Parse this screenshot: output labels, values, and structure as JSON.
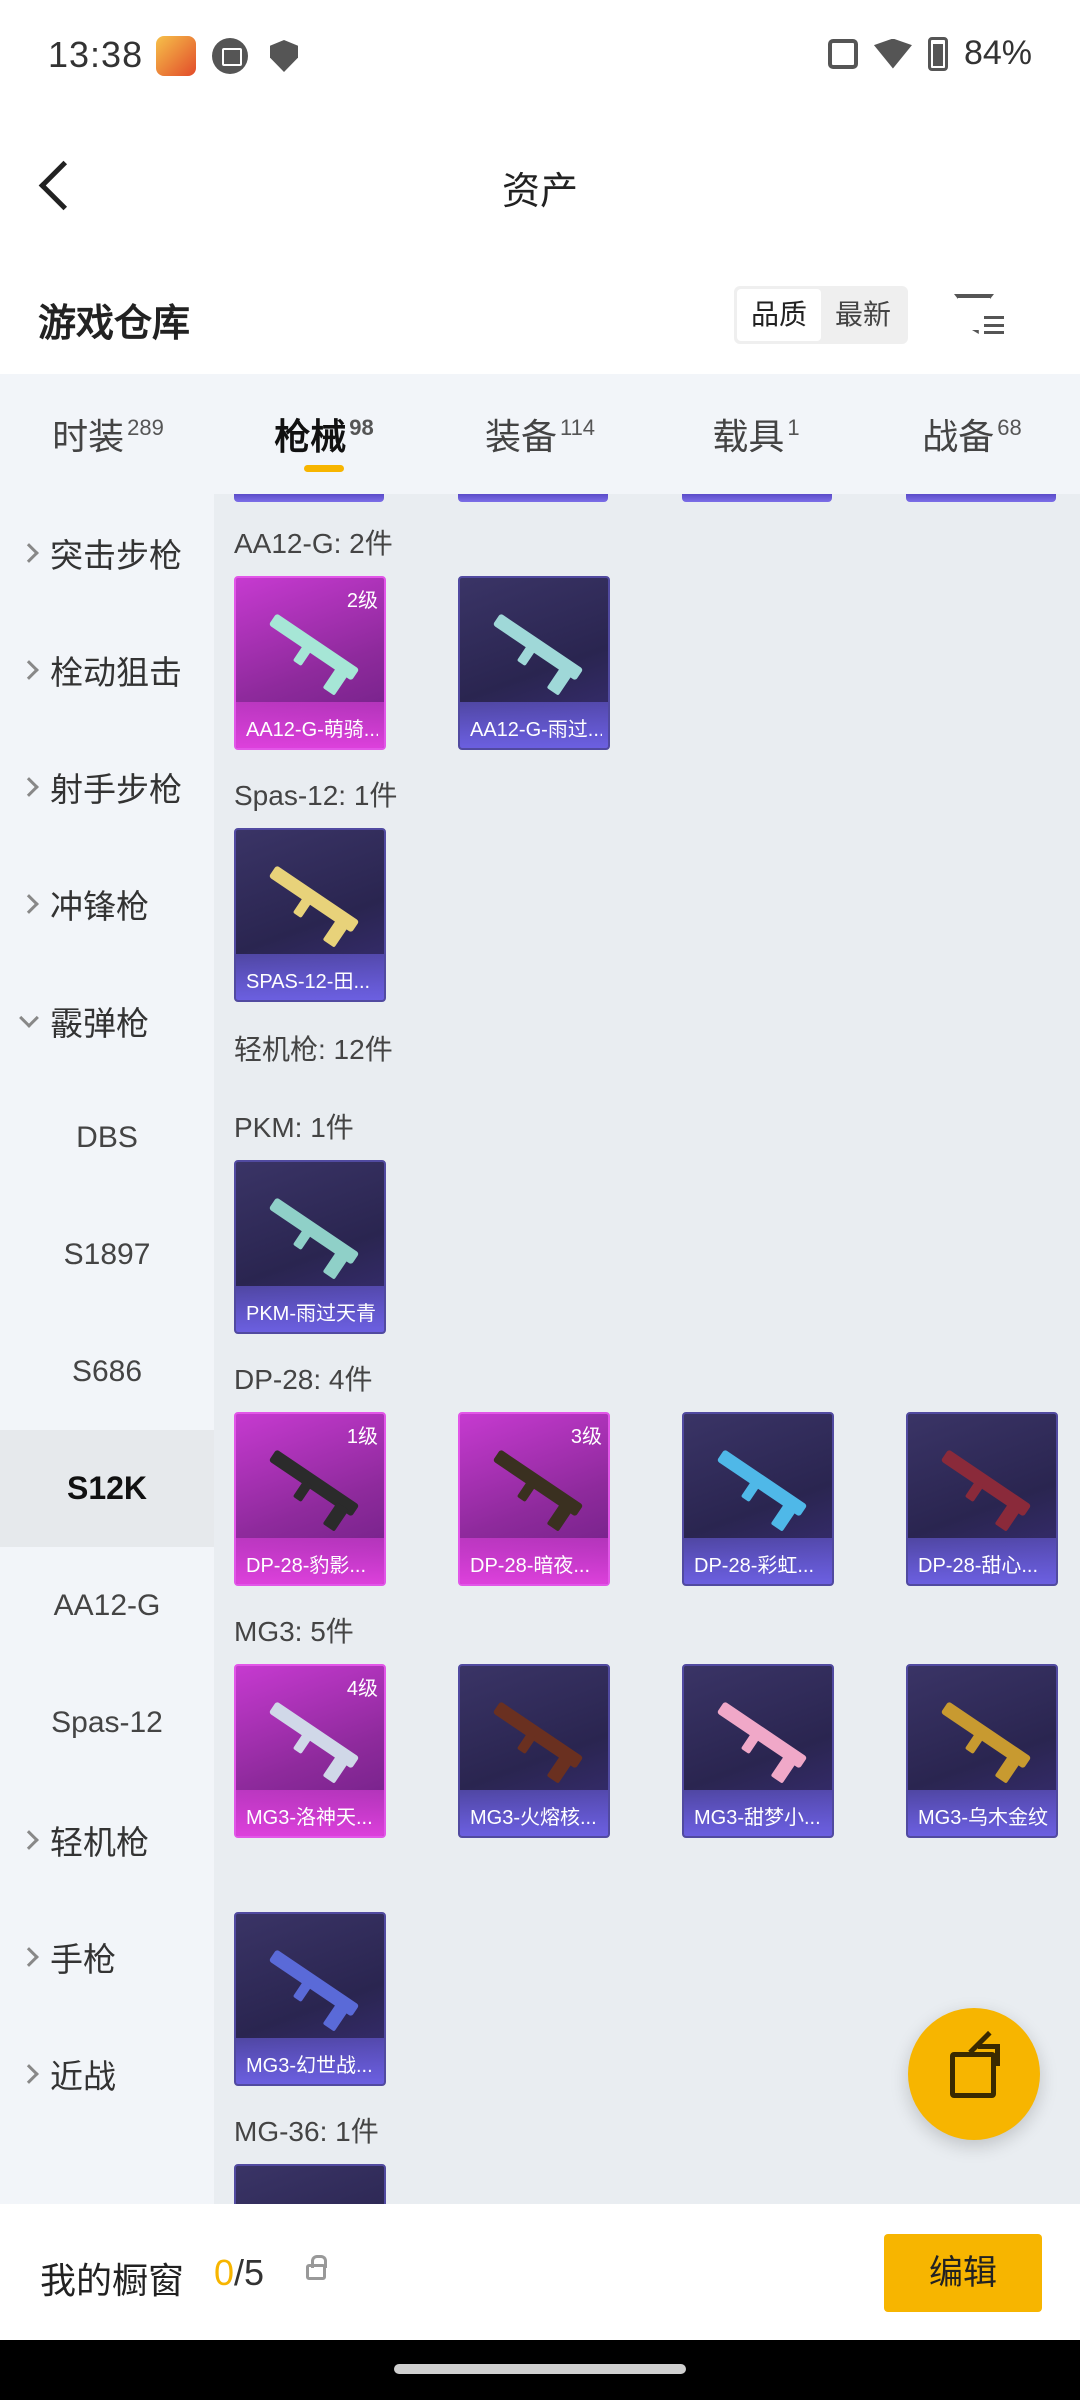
{
  "status_bar": {
    "time": "13:38",
    "battery": "84%"
  },
  "header": {
    "title": "资产"
  },
  "warehouse": {
    "title": "游戏仓库",
    "sort_quality": "品质",
    "sort_latest": "最新"
  },
  "tabs": [
    {
      "label": "时装",
      "count": "289"
    },
    {
      "label": "枪械",
      "count": "98"
    },
    {
      "label": "装备",
      "count": "114"
    },
    {
      "label": "载具",
      "count": "1"
    },
    {
      "label": "战备",
      "count": "68"
    }
  ],
  "sidebar": [
    {
      "label": "突击步枪",
      "type": "group"
    },
    {
      "label": "栓动狙击",
      "type": "group"
    },
    {
      "label": "射手步枪",
      "type": "group"
    },
    {
      "label": "冲锋枪",
      "type": "group"
    },
    {
      "label": "霰弹枪",
      "type": "group-open"
    },
    {
      "label": "DBS",
      "type": "sub"
    },
    {
      "label": "S1897",
      "type": "sub"
    },
    {
      "label": "S686",
      "type": "sub"
    },
    {
      "label": "S12K",
      "type": "sub-active"
    },
    {
      "label": "AA12-G",
      "type": "sub"
    },
    {
      "label": "Spas-12",
      "type": "sub"
    },
    {
      "label": "轻机枪",
      "type": "group"
    },
    {
      "label": "手枪",
      "type": "group"
    },
    {
      "label": "近战",
      "type": "group"
    }
  ],
  "sections": {
    "aa12": {
      "label": "AA12-G: 2件"
    },
    "spas": {
      "label": "Spas-12: 1件"
    },
    "lmg": {
      "label": "轻机枪: 12件"
    },
    "pkm": {
      "label": "PKM: 1件"
    },
    "dp28": {
      "label": "DP-28: 4件"
    },
    "mg3": {
      "label": "MG3: 5件"
    },
    "mg36": {
      "label": "MG-36: 1件"
    }
  },
  "items": {
    "aa12_1": {
      "name": "AA12-G-萌骑...",
      "level": "2级",
      "gun_color": "#a6e6d6"
    },
    "aa12_2": {
      "name": "AA12-G-雨过...",
      "gun_color": "#9fd8d8"
    },
    "spas_1": {
      "name": "SPAS-12-田...",
      "gun_color": "#e8d27a"
    },
    "pkm_1": {
      "name": "PKM-雨过天青",
      "gun_color": "#8fd0c8"
    },
    "dp28_1": {
      "name": "DP-28-豹影...",
      "level": "1级",
      "gun_color": "#2b2b2b"
    },
    "dp28_2": {
      "name": "DP-28-暗夜...",
      "level": "3级",
      "gun_color": "#3a3020"
    },
    "dp28_3": {
      "name": "DP-28-彩虹...",
      "gun_color": "#4fb8e8"
    },
    "dp28_4": {
      "name": "DP-28-甜心...",
      "gun_color": "#8a2a3a"
    },
    "mg3_1": {
      "name": "MG3-洛神天...",
      "level": "4级",
      "gun_color": "#d0d8e8"
    },
    "mg3_2": {
      "name": "MG3-火熔核...",
      "gun_color": "#6a3020"
    },
    "mg3_3": {
      "name": "MG3-甜梦小...",
      "gun_color": "#f0a8c8"
    },
    "mg3_4": {
      "name": "MG3-乌木金纹",
      "gun_color": "#c89a30"
    },
    "mg3_5": {
      "name": "MG3-幻世战...",
      "gun_color": "#5a6ad8"
    }
  },
  "bottom": {
    "label": "我的橱窗",
    "count_current": "0",
    "count_total": "/5",
    "edit": "编辑"
  },
  "colors": {
    "accent": "#f7b500",
    "rare_purple": "#6e62e6",
    "rare_pink": "#e242e0"
  }
}
